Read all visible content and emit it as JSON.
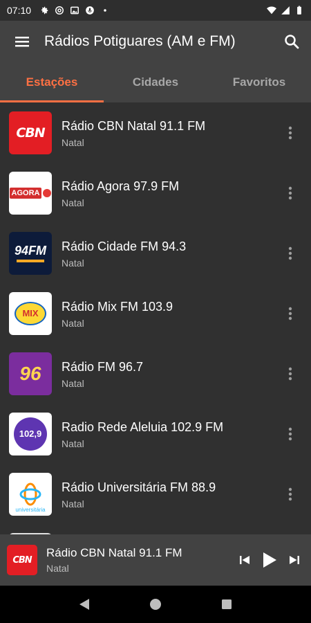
{
  "status_bar": {
    "time": "07:10",
    "icons": [
      "settings-icon",
      "at-sign-icon",
      "image-icon",
      "mic-icon",
      "dot-icon"
    ],
    "right_icons": [
      "wifi-icon",
      "signal-icon",
      "battery-icon"
    ]
  },
  "app_bar": {
    "title": "Rádios Potiguares (AM e FM)",
    "menu_icon": "hamburger-menu-icon",
    "search_icon": "search-icon"
  },
  "tabs": [
    {
      "label": "Estações",
      "active": true
    },
    {
      "label": "Cidades",
      "active": false
    },
    {
      "label": "Favoritos",
      "active": false
    }
  ],
  "stations": [
    {
      "name": "Rádio CBN Natal 91.1 FM",
      "city": "Natal",
      "logo_text": "CBN"
    },
    {
      "name": "Rádio Agora 97.9 FM",
      "city": "Natal",
      "logo_text": "AGORA"
    },
    {
      "name": "Rádio Cidade FM 94.3",
      "city": "Natal",
      "logo_text": "94FM"
    },
    {
      "name": "Rádio Mix FM 103.9",
      "city": "Natal",
      "logo_text": "MIX"
    },
    {
      "name": "Rádio FM 96.7",
      "city": "Natal",
      "logo_text": "96"
    },
    {
      "name": "Radio Rede Aleluia 102.9 FM",
      "city": "Natal",
      "logo_text": "102,9"
    },
    {
      "name": "Rádio Universitária FM 88.9",
      "city": "Natal",
      "logo_text": "universitária"
    }
  ],
  "player": {
    "name": "Rádio CBN Natal 91.1 FM",
    "city": "Natal",
    "logo_text": "CBN"
  },
  "colors": {
    "accent": "#ff7043",
    "app_bar": "#424242",
    "background": "#303030",
    "cbn_red": "#e31e24"
  }
}
